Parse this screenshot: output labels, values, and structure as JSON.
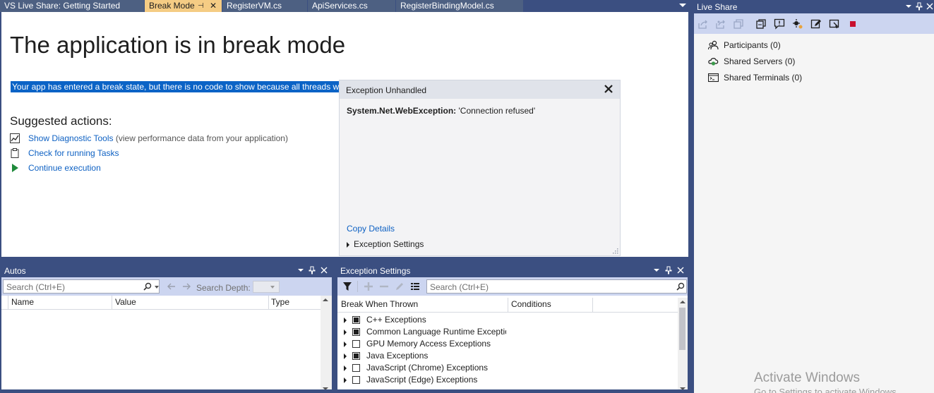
{
  "tabs": [
    {
      "label": "VS Live Share: Getting Started",
      "active": false
    },
    {
      "label": "Break Mode",
      "active": true
    },
    {
      "label": "RegisterVM.cs",
      "active": false
    },
    {
      "label": "ApiServices.cs",
      "active": false
    },
    {
      "label": "RegisterBindingModel.cs",
      "active": false
    }
  ],
  "break_mode": {
    "title": "The application is in break mode",
    "message": "Your app has entered a break state, but there is no code to show because all threads wer",
    "suggested_heading": "Suggested actions:",
    "actions": [
      {
        "link": "Show Diagnostic Tools",
        "description": "(view performance data from your application)",
        "icon": "diagnostic-chart-icon"
      },
      {
        "link": "Check for running Tasks",
        "description": "",
        "icon": "clipboard-icon"
      },
      {
        "link": "Continue execution",
        "description": "",
        "icon": "play-icon"
      }
    ]
  },
  "exception_popup": {
    "title": "Exception Unhandled",
    "type": "System.Net.WebException:",
    "message": "'Connection refused'",
    "copy_details": "Copy Details",
    "settings_label": "Exception Settings"
  },
  "live_share": {
    "title": "Live Share",
    "items": [
      {
        "label": "Participants (0)",
        "icon": "participants-icon"
      },
      {
        "label": "Shared Servers (0)",
        "icon": "shared-servers-icon"
      },
      {
        "label": "Shared Terminals (0)",
        "icon": "shared-terminals-icon"
      }
    ],
    "stop_color": "#c8102e"
  },
  "autos": {
    "title": "Autos",
    "search_placeholder": "Search (Ctrl+E)",
    "search_depth_label": "Search Depth:",
    "columns": [
      "Name",
      "Value",
      "Type"
    ]
  },
  "exception_settings": {
    "title": "Exception Settings",
    "search_placeholder": "Search (Ctrl+E)",
    "columns": [
      "Break When Thrown",
      "Conditions"
    ],
    "rows": [
      {
        "label": "C++ Exceptions",
        "checked": true
      },
      {
        "label": "Common Language Runtime Exceptions",
        "checked": true
      },
      {
        "label": "GPU Memory Access Exceptions",
        "checked": false
      },
      {
        "label": "Java Exceptions",
        "checked": true
      },
      {
        "label": "JavaScript (Chrome) Exceptions",
        "checked": false
      },
      {
        "label": "JavaScript (Edge) Exceptions",
        "checked": false
      }
    ]
  },
  "watermark": {
    "line1": "Activate Windows",
    "line2": "Go to Settings to activate Windows."
  },
  "colors": {
    "chrome": "#3b4f81",
    "active_tab": "#f5cc84",
    "link": "#0e61c3",
    "selection": "#0b63c6",
    "toolbar": "#ccd5f0"
  }
}
